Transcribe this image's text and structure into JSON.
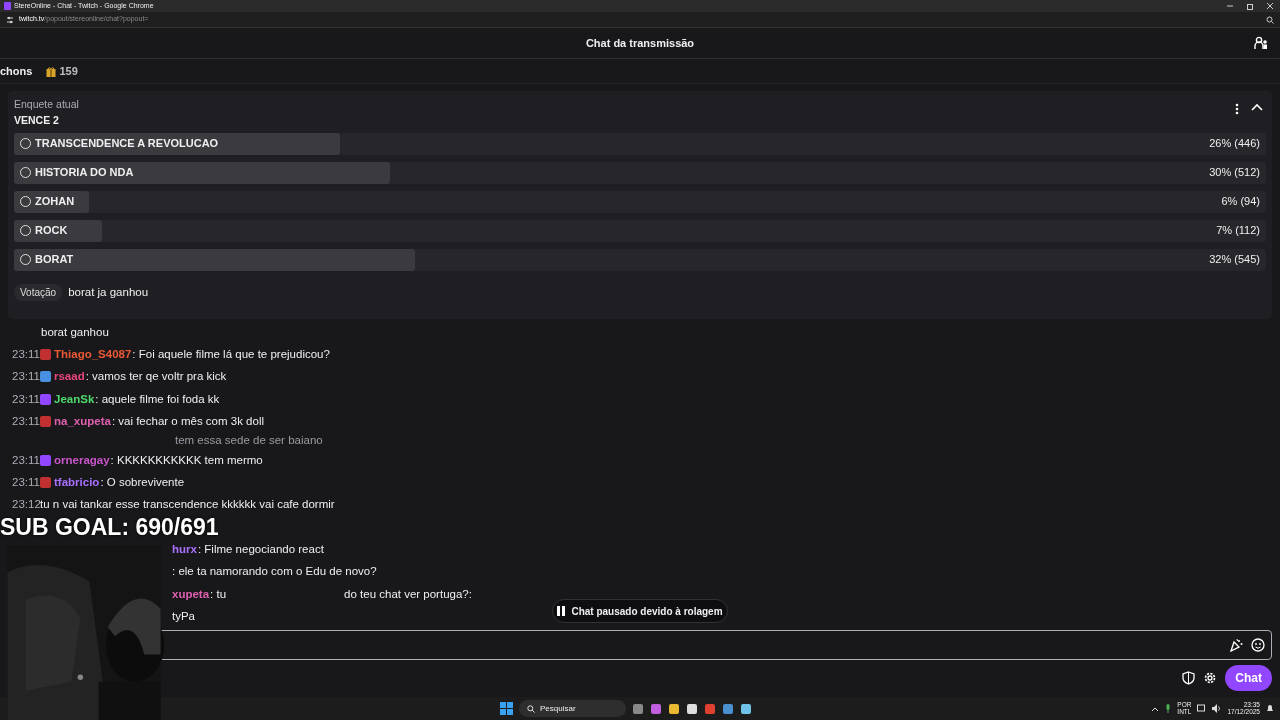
{
  "browser": {
    "title": "StereOnline - Chat - Twitch - Google Chrome",
    "url_host": "twitch.tv",
    "url_path": "/popout/stereonline/chat?popout="
  },
  "header": {
    "title": "Chat da transmissão"
  },
  "subheader": {
    "name": "chons",
    "gift_count": "159"
  },
  "poll": {
    "label": "Enquete atual",
    "title": "VENCE 2",
    "options": [
      {
        "label": "TRANSCENDENCE A REVOLUCAO",
        "level": 0.26,
        "result": "26% (446)"
      },
      {
        "label": "HISTORIA DO NDA",
        "level": 0.3,
        "result": "30% (512)"
      },
      {
        "label": "ZOHAN",
        "level": 0.06,
        "result": "6% (94)"
      },
      {
        "label": "ROCK",
        "level": 0.07,
        "result": "7% (112)"
      },
      {
        "label": "BORAT",
        "level": 0.32,
        "result": "32% (545)"
      }
    ]
  },
  "overlay": {
    "vote_label": "Votação",
    "vote_message": "borat ja ganhou"
  },
  "chat": {
    "lines": [
      {
        "kind": "overlay",
        "text": "borat ganhou"
      },
      {
        "kind": "message",
        "time": "23:11",
        "user": "Thiago_S4087",
        "color": "#eb5a34",
        "text": ": Foi aquele filme lá que te prejudicou?"
      },
      {
        "kind": "message",
        "time": "23:11",
        "user": "rsaad",
        "color": "#e8457f",
        "text": ": vamos ter qe voltr pra kick"
      },
      {
        "kind": "message",
        "time": "23:11",
        "user": "JeanSk",
        "color": "#4fd86a",
        "text": ": aquele filme foi foda kk"
      },
      {
        "kind": "message",
        "time": "23:11",
        "user": "na_xupeta",
        "color": "#e060b0",
        "text": ": vai fechar o mês com 3k doll"
      },
      {
        "kind": "reply",
        "text": "tem essa sede de ser baiano"
      },
      {
        "kind": "message",
        "time": "23:11",
        "user": "orneragay",
        "color": "#c955c9",
        "text": ": KKKKKKKKKKK tem mermo"
      },
      {
        "kind": "message",
        "time": "23:11",
        "user": "tfabricio",
        "color": "#a970ff",
        "text": ": O sobrevivente"
      },
      {
        "kind": "message",
        "time": "23:12",
        "text": "tu n vai tankar esse transcendence kkkkkk vai cafe dormir"
      },
      {
        "kind": "goal",
        "text": "SUB GOAL: 690/691"
      },
      {
        "kind": "partial",
        "user": "hurx",
        "color": "#a970ff",
        "text": ": Filme negociando react"
      },
      {
        "kind": "partial",
        "text": ": ele ta namorando com o Edu de novo?"
      },
      {
        "kind": "partial",
        "user": "xupeta",
        "color": "#e060b0",
        "text": ": tu",
        "text_after": "do teu chat ver portuga?:"
      },
      {
        "kind": "partial",
        "text": "tyPa"
      }
    ]
  },
  "pause": {
    "text": "Chat pausado devido à rolagem"
  },
  "actions": {
    "send": "Chat"
  },
  "taskbar": {
    "search": "Pesquisar",
    "lang": "POR",
    "layout": "INTL",
    "time": "23:35",
    "date": "17/12/2025"
  }
}
